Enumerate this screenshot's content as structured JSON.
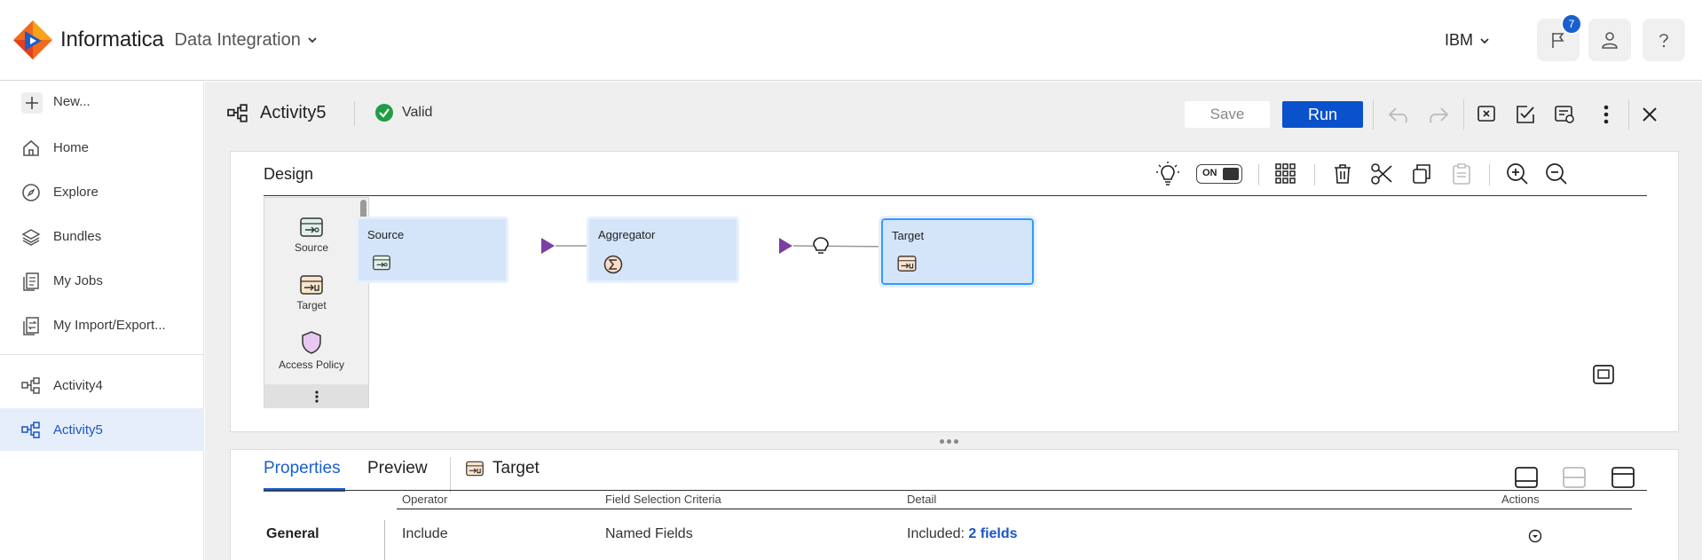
{
  "header": {
    "brand": "Informatica",
    "product": "Data Integration",
    "org": "IBM",
    "notification_count": "7",
    "icons": [
      "informatica-logo",
      "chevron-down-icon",
      "flag-icon",
      "user-icon",
      "help-icon"
    ]
  },
  "sidebar": {
    "new_label": "New...",
    "items": [
      {
        "label": "Home",
        "icon": "home-icon"
      },
      {
        "label": "Explore",
        "icon": "compass-icon"
      },
      {
        "label": "Bundles",
        "icon": "layers-icon"
      },
      {
        "label": "My Jobs",
        "icon": "jobs-icon"
      },
      {
        "label": "My Import/Export..."
      },
      {
        "label": "Activity4",
        "icon": "mapping-icon"
      },
      {
        "label": "Activity5",
        "icon": "mapping-icon",
        "active": true
      }
    ]
  },
  "toolbar": {
    "title": "Activity5",
    "status": "Valid",
    "save_label": "Save",
    "run_label": "Run",
    "colors": {
      "accent": "#0a52cc",
      "valid": "#1f9d46"
    }
  },
  "design": {
    "title": "Design",
    "toggle_label": "ON",
    "palette": [
      "Source",
      "Target",
      "Access Policy"
    ],
    "nodes": [
      "Source",
      "Aggregator",
      "Target"
    ],
    "selected_node": "Target"
  },
  "properties": {
    "tabs": [
      "Properties",
      "Preview"
    ],
    "active_tab": "Properties",
    "object_label": "Target",
    "columns": [
      "Operator",
      "Field Selection Criteria",
      "Detail",
      "Actions"
    ],
    "section": "General",
    "row": {
      "operator": "Include",
      "criteria": "Named Fields",
      "detail_prefix": "Included:",
      "detail_link": "2 fields"
    }
  }
}
